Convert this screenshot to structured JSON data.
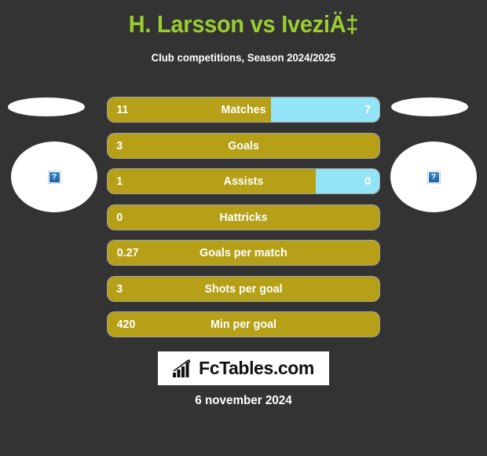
{
  "header": {
    "title": "H. Larsson vs IveziÄ‡",
    "subtitle": "Club competitions, Season 2024/2025"
  },
  "colors": {
    "background": "#333333",
    "title": "#9ACD32",
    "home_bar": "#B5A017",
    "away_bar": "#93E4F7",
    "text": "#FFFFFF",
    "logo_background": "#FFFFFF",
    "logo_text": "#111111"
  },
  "players": {
    "home": {
      "flag_icon": "flag-placeholder-oval",
      "photo_icon": "broken-image-icon",
      "photo_glyph": "?"
    },
    "away": {
      "flag_icon": "flag-placeholder-oval",
      "photo_icon": "broken-image-icon",
      "photo_glyph": "?"
    }
  },
  "stats": [
    {
      "label": "Matches",
      "home": "11",
      "away": "7",
      "home_pct": 60.0,
      "show_away": true
    },
    {
      "label": "Goals",
      "home": "3",
      "away": "",
      "home_pct": 100.0,
      "show_away": false
    },
    {
      "label": "Assists",
      "home": "1",
      "away": "0",
      "home_pct": 76.5,
      "show_away": true
    },
    {
      "label": "Hattricks",
      "home": "0",
      "away": "",
      "home_pct": 100.0,
      "show_away": false
    },
    {
      "label": "Goals per match",
      "home": "0.27",
      "away": "",
      "home_pct": 100.0,
      "show_away": false
    },
    {
      "label": "Shots per goal",
      "home": "3",
      "away": "",
      "home_pct": 100.0,
      "show_away": false
    },
    {
      "label": "Min per goal",
      "home": "420",
      "away": "",
      "home_pct": 100.0,
      "show_away": false
    }
  ],
  "footer": {
    "logo_text": "FcTables.com",
    "logo_icon": "bar-chart-trend-icon",
    "date": "6 november 2024"
  },
  "chart_data": {
    "type": "bar",
    "title": "H. Larsson vs IveziÄ‡",
    "subtitle": "Club competitions, Season 2024/2025",
    "categories": [
      "Matches",
      "Goals",
      "Assists",
      "Hattricks",
      "Goals per match",
      "Shots per goal",
      "Min per goal"
    ],
    "series": [
      {
        "name": "H. Larsson",
        "values": [
          11,
          3,
          1,
          0,
          0.27,
          3,
          420
        ]
      },
      {
        "name": "IveziÄ‡",
        "values": [
          7,
          null,
          0,
          null,
          null,
          null,
          null
        ]
      }
    ],
    "legend": "none",
    "grid": false,
    "xlabel": "",
    "ylabel": ""
  }
}
